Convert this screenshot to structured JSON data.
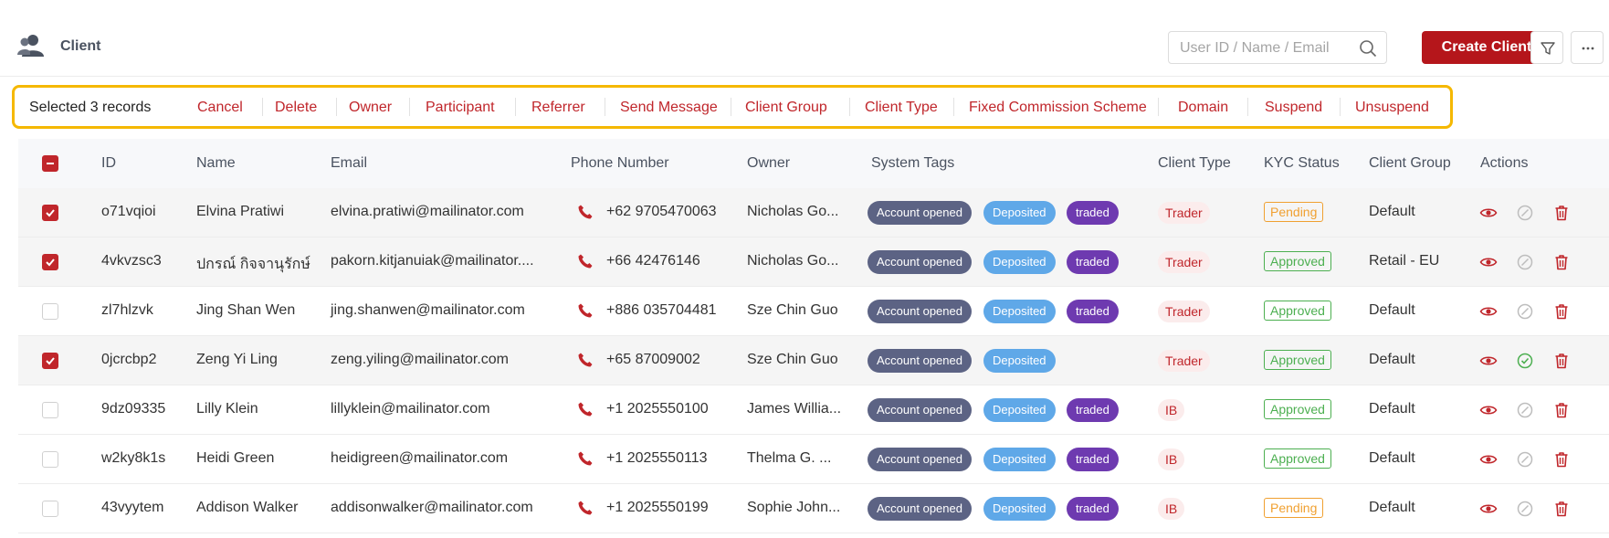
{
  "header": {
    "title": "Client",
    "search_placeholder": "User ID / Name / Email",
    "create_label": "Create Client"
  },
  "bulk": {
    "selected_text": "Selected 3 records",
    "actions": [
      "Cancel",
      "Delete",
      "Owner",
      "Participant",
      "Referrer",
      "Send Message",
      "Client Group",
      "Client Type",
      "Fixed Commission Scheme",
      "Domain",
      "Suspend",
      "Unsuspend"
    ]
  },
  "table": {
    "columns": [
      "ID",
      "Name",
      "Email",
      "Phone Number",
      "Owner",
      "System Tags",
      "Client Type",
      "KYC Status",
      "Client Group",
      "Actions"
    ],
    "rows": [
      {
        "selected": true,
        "id": "o71vqioi",
        "name": "Elvina Pratiwi",
        "email": "elvina.pratiwi@mailinator.com",
        "phone": "+62 9705470063",
        "owner": "Nicholas Go...",
        "tags": [
          "Account opened",
          "Deposited",
          "traded"
        ],
        "client_type": "Trader",
        "kyc": "Pending",
        "group": "Default",
        "verified": false
      },
      {
        "selected": true,
        "id": "4vkvzsc3",
        "name": "ปกรณ์ กิจจานุรักษ์",
        "email": "pakorn.kitjanuiak@mailinator....",
        "phone": "+66 42476146",
        "owner": "Nicholas Go...",
        "tags": [
          "Account opened",
          "Deposited",
          "traded"
        ],
        "client_type": "Trader",
        "kyc": "Approved",
        "group": "Retail - EU",
        "verified": false
      },
      {
        "selected": false,
        "id": "zl7hlzvk",
        "name": "Jing Shan Wen",
        "email": "jing.shanwen@mailinator.com",
        "phone": "+886 035704481",
        "owner": "Sze Chin Guo",
        "tags": [
          "Account opened",
          "Deposited",
          "traded"
        ],
        "client_type": "Trader",
        "kyc": "Approved",
        "group": "Default",
        "verified": false
      },
      {
        "selected": true,
        "id": "0jcrcbp2",
        "name": "Zeng Yi Ling",
        "email": "zeng.yiling@mailinator.com",
        "phone": "+65 87009002",
        "owner": "Sze Chin Guo",
        "tags": [
          "Account opened",
          "Deposited"
        ],
        "client_type": "Trader",
        "kyc": "Approved",
        "group": "Default",
        "verified": true
      },
      {
        "selected": false,
        "id": "9dz09335",
        "name": "Lilly Klein",
        "email": "lillyklein@mailinator.com",
        "phone": "+1 2025550100",
        "owner": "James Willia...",
        "tags": [
          "Account opened",
          "Deposited",
          "traded"
        ],
        "client_type": "IB",
        "kyc": "Approved",
        "group": "Default",
        "verified": false
      },
      {
        "selected": false,
        "id": "w2ky8k1s",
        "name": "Heidi Green",
        "email": "heidigreen@mailinator.com",
        "phone": "+1 2025550113",
        "owner": "Thelma G. ...",
        "tags": [
          "Account opened",
          "Deposited",
          "traded"
        ],
        "client_type": "IB",
        "kyc": "Approved",
        "group": "Default",
        "verified": false
      },
      {
        "selected": false,
        "id": "43vyytem",
        "name": "Addison Walker",
        "email": "addisonwalker@mailinator.com",
        "phone": "+1 2025550199",
        "owner": "Sophie John...",
        "tags": [
          "Account opened",
          "Deposited",
          "traded"
        ],
        "client_type": "IB",
        "kyc": "Pending",
        "group": "Default",
        "verified": false
      }
    ]
  },
  "colors": {
    "brand": "#b5161b",
    "accent_red": "#c0262b",
    "highlight_border": "#f5b800",
    "tag_account_opened": "#5c6384",
    "tag_deposited": "#5fa8e8",
    "tag_traded": "#6e3ab0",
    "kyc_approved": "#4caf50",
    "kyc_pending": "#f0a030"
  },
  "icons": {
    "page": "users-icon",
    "search": "search-icon",
    "filter": "filter-icon",
    "more": "more-horizontal-icon",
    "phone": "phone-icon",
    "view": "eye-icon",
    "verify": "check-circle-icon",
    "delete": "trash-icon"
  }
}
